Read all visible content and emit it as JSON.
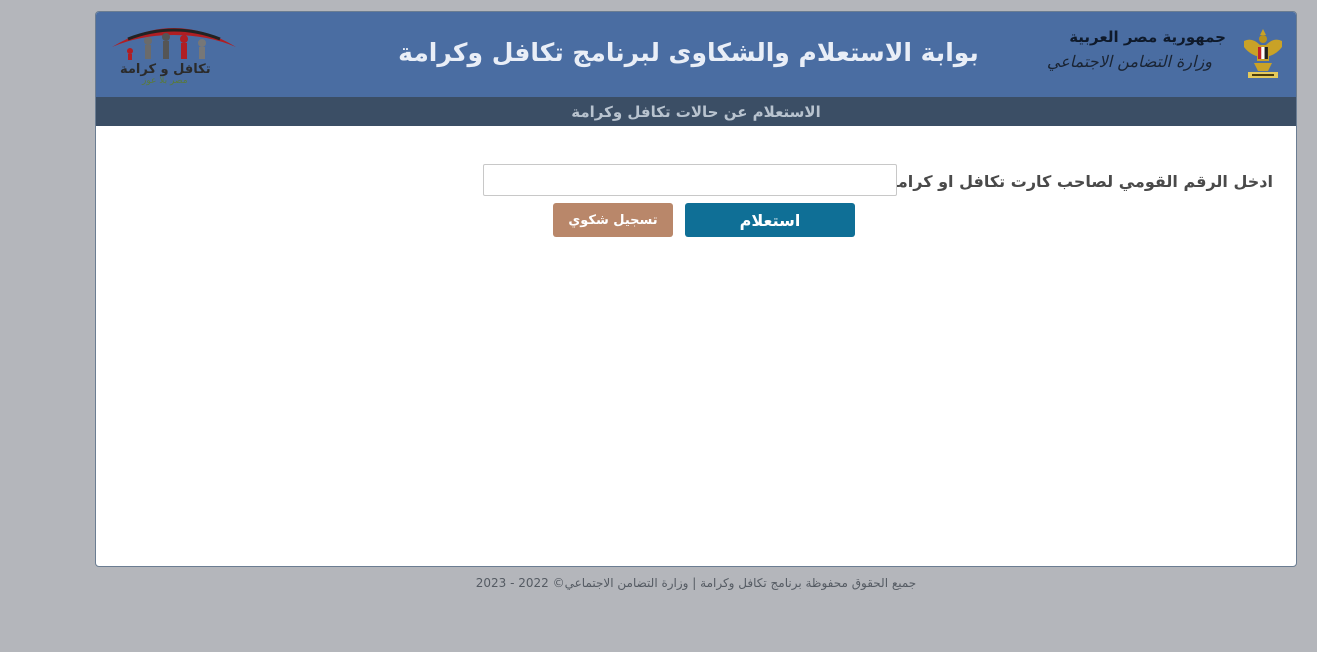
{
  "header": {
    "page_title": "بوابة الاستعلام والشكاوى لبرنامج تكافل وكرامة",
    "government_name": "جمهورية مصر العربية",
    "ministry_name": "وزارة التضامن الاجتماعي",
    "program_logo_text": "تكافل و كرامة",
    "program_logo_tagline": "مصر بلا عوز",
    "emblem_icon": "egypt-eagle-emblem-icon",
    "logo_icon": "takaful-karama-logo-icon"
  },
  "subbar": {
    "title": "الاستعلام عن حالات تكافل وكرامة"
  },
  "form": {
    "national_id_label": "ادخل الرقم القومي لصاحب كارت تكافل او كرامة:",
    "national_id_value": "",
    "national_id_placeholder": "",
    "inquiry_button_label": "استعلام",
    "complaint_button_label": "تسجيل شكوي"
  },
  "footer": {
    "copyright": "جميع الحقوق محفوظة برنامج تكافل وكرامة | وزارة التضامن الاجتماعي© 2022 - 2023"
  },
  "colors": {
    "header_bg": "#4a6da2",
    "subbar_bg": "#3b4e65",
    "inquiry_button_bg": "#0f6f96",
    "complaint_button_bg": "#b9876a",
    "page_bg": "#b4b6bb"
  }
}
